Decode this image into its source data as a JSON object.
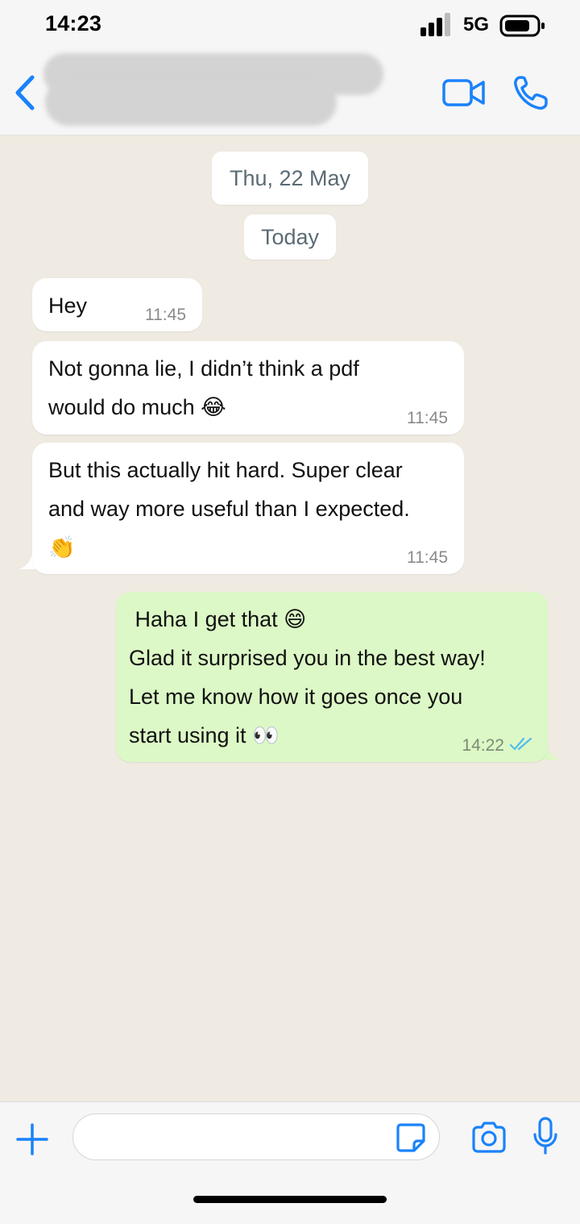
{
  "status_bar": {
    "time": "14:23",
    "network": "5G",
    "icons": [
      "signal-icon",
      "battery-icon"
    ]
  },
  "header": {
    "contact_name_redacted": true,
    "icons": [
      "chevron-left-icon",
      "video-call-icon",
      "phone-icon"
    ],
    "accent_color": "#1a82fb"
  },
  "chat": {
    "date_chips": [
      "Thu, 22 May",
      "Today"
    ],
    "messages": [
      {
        "direction": "incoming",
        "text": "Hey",
        "time": "11:45"
      },
      {
        "direction": "incoming",
        "text": "Not gonna lie, I didn’t think a pdf\nwould do much 😂",
        "time": "11:45"
      },
      {
        "direction": "incoming",
        "text": "But this actually hit hard. Super clear\nand way more useful than I expected.\n👏",
        "time": "11:45"
      },
      {
        "direction": "outgoing",
        "text": " Haha I get that 😄\nGlad it surprised you in the best way!\nLet me know how it goes once you\nstart using it 👀",
        "time": "14:22",
        "status": "read"
      }
    ],
    "incoming_bubble_color": "#ffffff",
    "outgoing_bubble_color": "#dcf8c6",
    "background_color": "#efeae2"
  },
  "input_bar": {
    "placeholder": "",
    "icons": [
      "plus-icon",
      "sticker-icon",
      "camera-icon",
      "microphone-icon"
    ]
  }
}
